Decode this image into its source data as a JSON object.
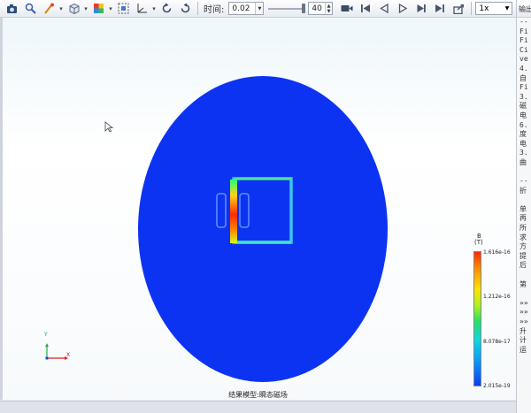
{
  "toolbar": {
    "time_label": "时间:",
    "time_value": "0.02",
    "frame_value": "40",
    "speed_value": "1x",
    "icons": [
      "camera-icon",
      "zoom-icon",
      "brush-icon",
      "cube-icon",
      "color-map-icon",
      "fit-view-icon",
      "axes-icon",
      "rotate-left-icon",
      "rotate-right-icon",
      "record-icon",
      "first-frame-icon",
      "step-back-icon",
      "play-icon",
      "step-forward-icon",
      "last-frame-icon",
      "export-icon"
    ]
  },
  "side_panel": {
    "title": "输出",
    "lines": [
      "--",
      "Fi",
      "Fi",
      "Ci",
      "ve",
      "4.",
      "自",
      "Fi",
      "3.",
      "磁",
      "电",
      "6.",
      "度",
      "电",
      "3.",
      "曲",
      "",
      "--",
      "折",
      "",
      "单",
      "再",
      "所",
      "求",
      "方",
      "提",
      "后",
      "",
      "第",
      "",
      "»»",
      "»»",
      "»»",
      "升",
      "计",
      "运"
    ]
  },
  "legend": {
    "title": "B",
    "unit": "(T)",
    "ticks": [
      "1.616e-16",
      "1.212e-16",
      "8.078e-17",
      "2.015e-19"
    ],
    "colors": {
      "max": "#ff2a00",
      "min": "#0d3df2"
    }
  },
  "axes": {
    "x": "X",
    "y": "Y"
  },
  "status": {
    "caption": "结果模型:瞬态磁场"
  },
  "colors": {
    "background_disk": "#0d33f2",
    "accent": "#ff2a00"
  }
}
